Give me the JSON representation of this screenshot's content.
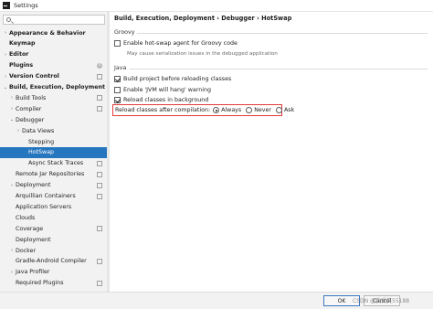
{
  "window": {
    "title": "Settings"
  },
  "sidebar": {
    "search_placeholder": "",
    "items": [
      {
        "label": "Appearance & Behavior",
        "arrow": "›",
        "bold": true
      },
      {
        "label": "Keymap",
        "arrow": "",
        "bold": true
      },
      {
        "label": "Editor",
        "arrow": "›",
        "bold": true
      },
      {
        "label": "Plugins",
        "arrow": "",
        "bold": true,
        "badge": "1"
      },
      {
        "label": "Version Control",
        "arrow": "›",
        "bold": true,
        "proj": true
      },
      {
        "label": "Build, Execution, Deployment",
        "arrow": "⌄",
        "bold": true
      },
      {
        "label": "Build Tools",
        "arrow": "›",
        "proj": true
      },
      {
        "label": "Compiler",
        "arrow": "›",
        "proj": true
      },
      {
        "label": "Debugger",
        "arrow": "⌄"
      },
      {
        "label": "Data Views",
        "arrow": "›"
      },
      {
        "label": "Stepping",
        "arrow": ""
      },
      {
        "label": "HotSwap",
        "arrow": "",
        "selected": true
      },
      {
        "label": "Async Stack Traces",
        "arrow": "",
        "proj": true
      },
      {
        "label": "Remote Jar Repositories",
        "arrow": "",
        "proj": true
      },
      {
        "label": "Deployment",
        "arrow": "›",
        "proj": true
      },
      {
        "label": "Arquillian Containers",
        "arrow": "",
        "proj": true
      },
      {
        "label": "Application Servers",
        "arrow": ""
      },
      {
        "label": "Clouds",
        "arrow": ""
      },
      {
        "label": "Coverage",
        "arrow": "",
        "proj": true
      },
      {
        "label": "Deployment",
        "arrow": ""
      },
      {
        "label": "Docker",
        "arrow": "›"
      },
      {
        "label": "Gradle-Android Compiler",
        "arrow": "",
        "proj": true
      },
      {
        "label": "Java Profiler",
        "arrow": "›"
      },
      {
        "label": "Required Plugins",
        "arrow": "",
        "proj": true
      }
    ],
    "help_label": "?"
  },
  "content": {
    "breadcrumb": "Build, Execution, Deployment  ›  Debugger  ›  HotSwap",
    "groovy": {
      "title": "Groovy",
      "enable_hotswap_label": "Enable hot-swap agent for Groovy code",
      "enable_hotswap_checked": false,
      "hint": "May cause serialization issues in the debugged application"
    },
    "java": {
      "title": "Java",
      "build_project_label": "Build project before reloading classes",
      "build_project_checked": true,
      "jvm_warning_label": "Enable 'JVM will hang' warning",
      "jvm_warning_checked": false,
      "reload_background_label": "Reload classes in background",
      "reload_background_checked": true,
      "reload_after_label": "Reload classes after compilation:",
      "options": [
        {
          "label": "Always",
          "selected": true
        },
        {
          "label": "Never",
          "selected": false
        },
        {
          "label": "Ask",
          "selected": false
        }
      ]
    }
  },
  "footer": {
    "ok_label": "OK",
    "cancel_label": "Cancel",
    "watermark": "CSDN @我爱笑55188"
  },
  "colors": {
    "selection": "#2675bf",
    "highlight_border": "#e23b3b",
    "sidebar_bg": "#f2f2f2"
  }
}
